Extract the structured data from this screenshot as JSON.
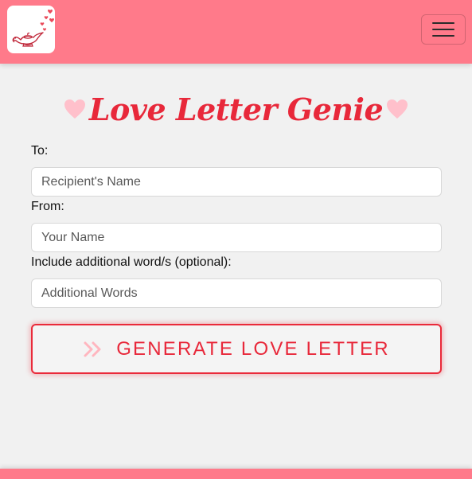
{
  "header": {
    "logo_icon": "magic-lamp-with-hearts-icon",
    "menu_icon": "hamburger-menu-icon",
    "background_color": "#ff7a8a"
  },
  "title": {
    "text": "Love Letter Genie",
    "heart_icon": "heart-icon",
    "color": "#e8283a",
    "heart_color": "#ffc0cb"
  },
  "form": {
    "to": {
      "label": "To:",
      "placeholder": "Recipient's Name",
      "value": ""
    },
    "from": {
      "label": "From:",
      "placeholder": "Your Name",
      "value": ""
    },
    "additional": {
      "label": "Include additional word/s (optional):",
      "placeholder": "Additional Words",
      "value": ""
    },
    "generate_button": {
      "label": "GENERATE LOVE LETTER",
      "icon": "double-chevron-right-icon",
      "color": "#ea2a3a"
    }
  }
}
